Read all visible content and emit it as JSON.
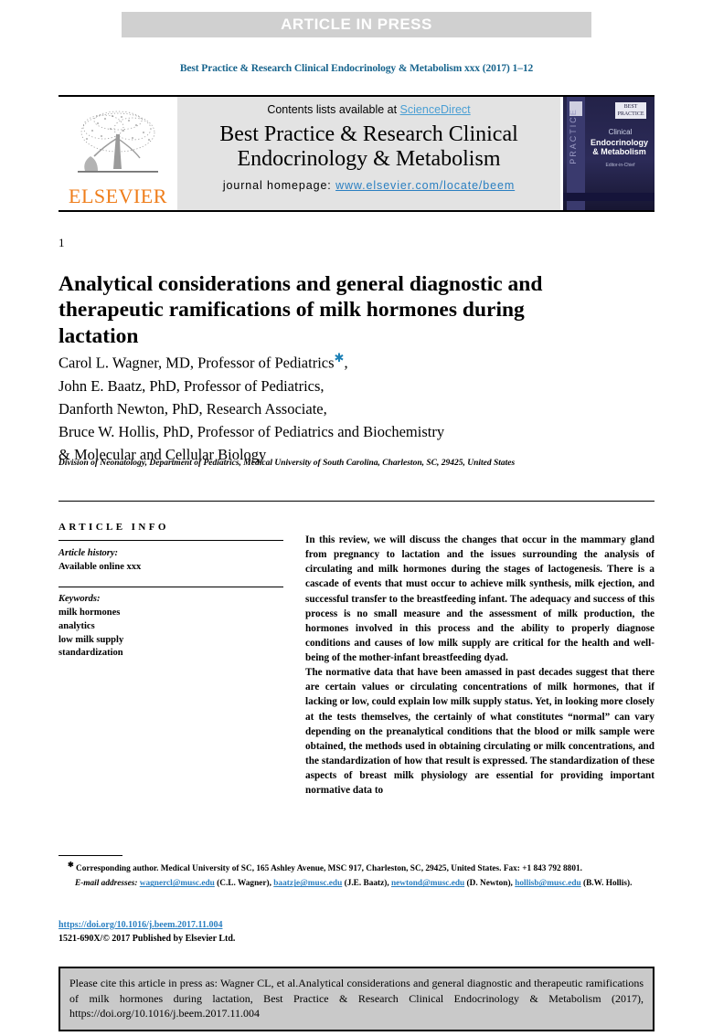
{
  "banner": {
    "label": "ARTICLE IN PRESS",
    "band_color": "#d0d0d0",
    "text_color": "#ffffff"
  },
  "running_head": "Best Practice & Research Clinical Endocrinology & Metabolism xxx (2017) 1–12",
  "masthead": {
    "publisher_name": "ELSEVIER",
    "publisher_color": "#ef7d1a",
    "contents_prefix": "Contents lists available at ",
    "contents_link": "ScienceDirect",
    "contents_link_color": "#4a9fd4",
    "journal_title_line1": "Best Practice & Research Clinical",
    "journal_title_line2": "Endocrinology & Metabolism",
    "homepage_label": "journal homepage: ",
    "homepage_url": "www.elsevier.com/locate/beem",
    "homepage_url_color": "#2a7fc1",
    "cover": {
      "spine_text": "PRACTICE",
      "badge_line1": "BEST",
      "badge_line2": "PRACTICE",
      "title_line1": "Clinical",
      "title_line2": "Endocrinology",
      "title_line3": "& Metabolism",
      "subtitle": "Editor-in-Chief",
      "background_color": "#1c1b3a"
    }
  },
  "article": {
    "page_number": "1",
    "title": "Analytical considerations and general diagnostic and therapeutic ramifications of milk hormones during lactation",
    "authors": [
      {
        "name": "Carol L. Wagner, MD, Professor of Pediatrics",
        "corresponding": true,
        "trailing": ","
      },
      {
        "name": "John E. Baatz, PhD, Professor of Pediatrics,",
        "corresponding": false,
        "trailing": ""
      },
      {
        "name": "Danforth Newton, PhD, Research Associate,",
        "corresponding": false,
        "trailing": ""
      },
      {
        "name": "Bruce W. Hollis, PhD, Professor of Pediatrics and Biochemistry",
        "corresponding": false,
        "trailing": ""
      },
      {
        "name": "& Molecular and Cellular Biology",
        "corresponding": false,
        "trailing": ""
      }
    ],
    "affiliation": "Division of Neonatology, Department of Pediatrics, Medical University of South Carolina, Charleston, SC, 29425, United States"
  },
  "article_info": {
    "heading": "ARTICLE INFO",
    "history_label": "Article history:",
    "history_value": "Available online xxx",
    "keywords_label": "Keywords:",
    "keywords": [
      "milk hormones",
      "analytics",
      "low milk supply",
      "standardization"
    ]
  },
  "abstract": {
    "paragraph1": "In this review, we will discuss the changes that occur in the mammary gland from pregnancy to lactation and the issues surrounding the analysis of circulating and milk hormones during the stages of lactogenesis. There is a cascade of events that must occur to achieve milk synthesis, milk ejection, and successful transfer to the breastfeeding infant. The adequacy and success of this process is no small measure and the assessment of milk production, the hormones involved in this process and the ability to properly diagnose conditions and causes of low milk supply are critical for the health and well-being of the mother-infant breastfeeding dyad.",
    "paragraph2": "The normative data that have been amassed in past decades suggest that there are certain values or circulating concentrations of milk hormones, that if lacking or low, could explain low milk supply status. Yet, in looking more closely at the tests themselves, the certainly of what constitutes “normal” can vary depending on the preanalytical conditions that the blood or milk sample were obtained, the methods used in obtaining circulating or milk concentrations, and the standardization of how that result is expressed. The standardization of these aspects of breast milk physiology are essential for providing important normative data to"
  },
  "footnotes": {
    "corresponding": "Corresponding author. Medical University of SC, 165 Ashley Avenue, MSC 917, Charleston, SC, 29425, United States. Fax: +1 843 792 8801.",
    "email_label": "E-mail addresses:",
    "emails": [
      {
        "address": "wagnercl@musc.edu",
        "owner": "(C.L. Wagner)"
      },
      {
        "address": "baatzje@musc.edu",
        "owner": "(J.E. Baatz)"
      },
      {
        "address": "newtond@musc.edu",
        "owner": "(D. Newton)"
      },
      {
        "address": "hollisb@musc.edu",
        "owner": "(B.W. Hollis)"
      }
    ]
  },
  "doi_block": {
    "doi_url": "https://doi.org/10.1016/j.beem.2017.11.004",
    "copyright": "1521-690X/© 2017 Published by Elsevier Ltd."
  },
  "citation_box": {
    "text": "Please cite this article in press as: Wagner CL, et al.Analytical considerations and general diagnostic and therapeutic ramifications of milk hormones during lactation, Best Practice & Research Clinical Endocrinology & Metabolism (2017), https://doi.org/10.1016/j.beem.2017.11.004",
    "background_color": "#c9c9c9"
  }
}
